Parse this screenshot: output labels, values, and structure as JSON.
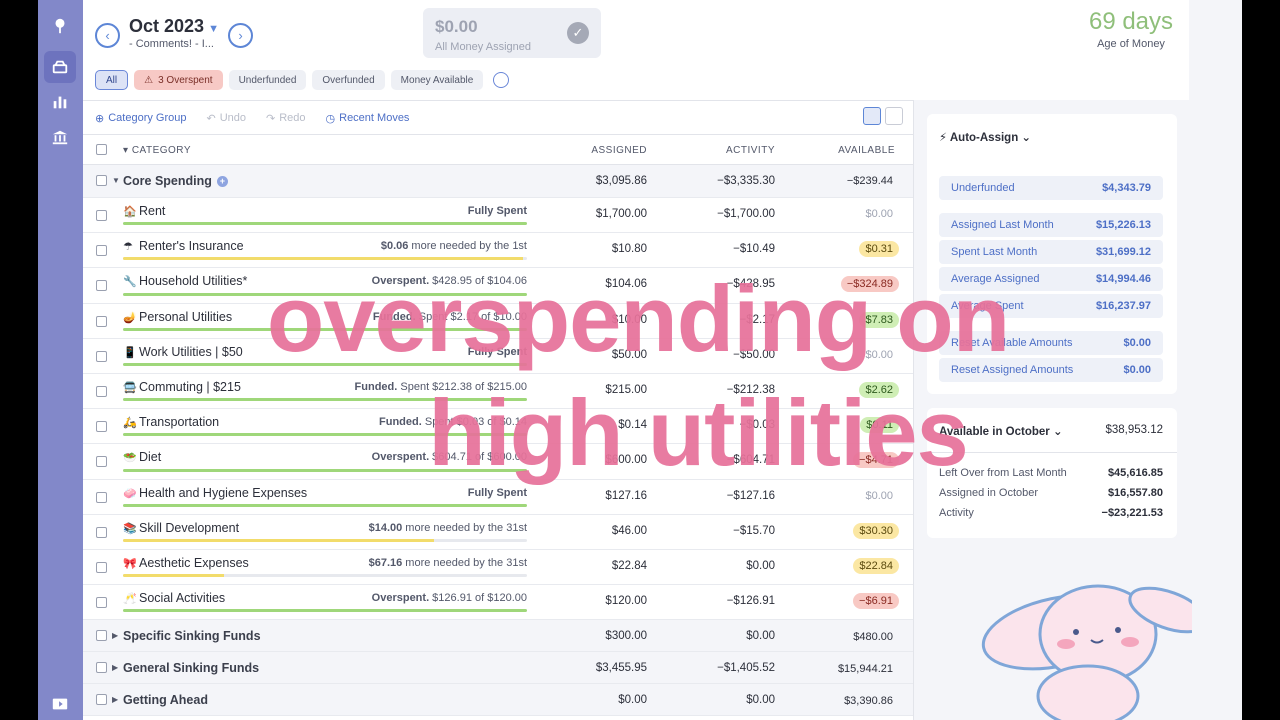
{
  "header": {
    "month": "Oct 2023",
    "month_note": "- Comments! - I...",
    "assigned_amount": "$0.00",
    "assigned_label": "All Money Assigned",
    "age_of_money": "69 days",
    "age_of_money_label": "Age of Money"
  },
  "filters": {
    "all": "All",
    "overspent": "3 Overspent",
    "underfunded": "Underfunded",
    "overfunded": "Overfunded",
    "money_available": "Money Available"
  },
  "toolbar": {
    "category_group": "Category Group",
    "undo": "Undo",
    "redo": "Redo",
    "recent_moves": "Recent Moves"
  },
  "columns": {
    "category": "CATEGORY",
    "assigned": "ASSIGNED",
    "activity": "ACTIVITY",
    "available": "AVAILABLE"
  },
  "core": {
    "name": "Core Spending",
    "assigned": "$3,095.86",
    "activity": "−$3,335.30",
    "available": "−$239.44"
  },
  "categories": [
    {
      "emoji": "🏠",
      "name": "Rent",
      "status_bold": "Fully Spent",
      "status_rest": "",
      "progress": 1.0,
      "bar_color": "#9fd77a",
      "assigned": "$1,700.00",
      "activity": "−$1,700.00",
      "available": "$0.00",
      "av_style": "zero"
    },
    {
      "emoji": "☂",
      "name": "Renter's Insurance",
      "status_bold": "$0.06",
      "status_rest": " more needed by the 1st",
      "progress": 0.99,
      "bar_color": "#f2dc6b",
      "assigned": "$10.80",
      "activity": "−$10.49",
      "available": "$0.31",
      "av_style": "yellow"
    },
    {
      "emoji": "🔧",
      "name": "Household Utilities*",
      "status_bold": "Overspent.",
      "status_rest": " $428.95 of $104.06",
      "progress": 1.0,
      "bar_color": "#9fd77a",
      "assigned": "$104.06",
      "activity": "−$428.95",
      "available": "−$324.89",
      "av_style": "red"
    },
    {
      "emoji": "🪔",
      "name": "Personal Utilities",
      "status_bold": "Funded.",
      "status_rest": " Spent $2.17 of $10.00",
      "progress": 1.0,
      "bar_color": "#9fd77a",
      "assigned": "$10.00",
      "activity": "−$2.17",
      "available": "$7.83",
      "av_style": "green"
    },
    {
      "emoji": "📱",
      "name": "Work Utilities | $50",
      "status_bold": "Fully Spent",
      "status_rest": "",
      "progress": 1.0,
      "bar_color": "#9fd77a",
      "assigned": "$50.00",
      "activity": "−$50.00",
      "available": "$0.00",
      "av_style": "zero"
    },
    {
      "emoji": "🚍",
      "name": "Commuting | $215",
      "status_bold": "Funded.",
      "status_rest": " Spent $212.38 of $215.00",
      "progress": 1.0,
      "bar_color": "#9fd77a",
      "assigned": "$215.00",
      "activity": "−$212.38",
      "available": "$2.62",
      "av_style": "green"
    },
    {
      "emoji": "🛵",
      "name": "Transportation",
      "status_bold": "Funded.",
      "status_rest": " Spent $0.03 of $0.14",
      "progress": 1.0,
      "bar_color": "#9fd77a",
      "assigned": "$0.14",
      "activity": "−$0.03",
      "available": "$0.11",
      "av_style": "green"
    },
    {
      "emoji": "🥗",
      "name": "Diet",
      "status_bold": "Overspent.",
      "status_rest": " $604.71 of $600.00",
      "progress": 1.0,
      "bar_color": "#9fd77a",
      "assigned": "$600.00",
      "activity": "−$604.71",
      "available": "−$4.71",
      "av_style": "red"
    },
    {
      "emoji": "🧼",
      "name": "Health and Hygiene Expenses",
      "status_bold": "Fully Spent",
      "status_rest": "",
      "progress": 1.0,
      "bar_color": "#9fd77a",
      "assigned": "$127.16",
      "activity": "−$127.16",
      "available": "$0.00",
      "av_style": "zero"
    },
    {
      "emoji": "📚",
      "name": "Skill Development",
      "status_bold": "$14.00",
      "status_rest": " more needed by the 31st",
      "progress": 0.77,
      "bar_color": "#f2dc6b",
      "assigned": "$46.00",
      "activity": "−$15.70",
      "available": "$30.30",
      "av_style": "yellow"
    },
    {
      "emoji": "🎀",
      "name": "Aesthetic Expenses",
      "status_bold": "$67.16",
      "status_rest": " more needed by the 31st",
      "progress": 0.25,
      "bar_color": "#f2dc6b",
      "assigned": "$22.84",
      "activity": "$0.00",
      "available": "$22.84",
      "av_style": "yellow"
    },
    {
      "emoji": "🥂",
      "name": "Social Activities",
      "status_bold": "Overspent.",
      "status_rest": " $126.91 of $120.00",
      "progress": 1.0,
      "bar_color": "#9fd77a",
      "assigned": "$120.00",
      "activity": "−$126.91",
      "available": "−$6.91",
      "av_style": "red"
    }
  ],
  "groups": [
    {
      "name": "Specific Sinking Funds",
      "assigned": "$300.00",
      "activity": "$0.00",
      "available": "$480.00"
    },
    {
      "name": "General Sinking Funds",
      "assigned": "$3,455.95",
      "activity": "−$1,405.52",
      "available": "$15,944.21"
    },
    {
      "name": "Getting Ahead",
      "assigned": "$0.00",
      "activity": "$0.00",
      "available": "$3,390.86"
    }
  ],
  "auto_assign": {
    "title": "Auto-Assign",
    "items": [
      {
        "label": "Underfunded",
        "value": "$4,343.79"
      },
      {
        "label": "Assigned Last Month",
        "value": "$15,226.13"
      },
      {
        "label": "Spent Last Month",
        "value": "$31,699.12"
      },
      {
        "label": "Average Assigned",
        "value": "$14,994.46"
      },
      {
        "label": "Average Spent",
        "value": "$16,237.97"
      },
      {
        "label": "Reset Available Amounts",
        "value": "$0.00"
      },
      {
        "label": "Reset Assigned Amounts",
        "value": "$0.00"
      }
    ]
  },
  "available_month": {
    "title": "Available in October",
    "total": "$38,953.12",
    "items": [
      {
        "label": "Left Over from Last Month",
        "value": "$45,616.85"
      },
      {
        "label": "Assigned in October",
        "value": "$16,557.80"
      },
      {
        "label": "Activity",
        "value": "−$23,221.53"
      }
    ]
  },
  "overlay": {
    "line1": "overspending on",
    "line2": "high utilities"
  },
  "colors": {
    "sidebar": "#8288c9",
    "accent": "#5d86d6",
    "overlay_text": "#e7729a"
  }
}
